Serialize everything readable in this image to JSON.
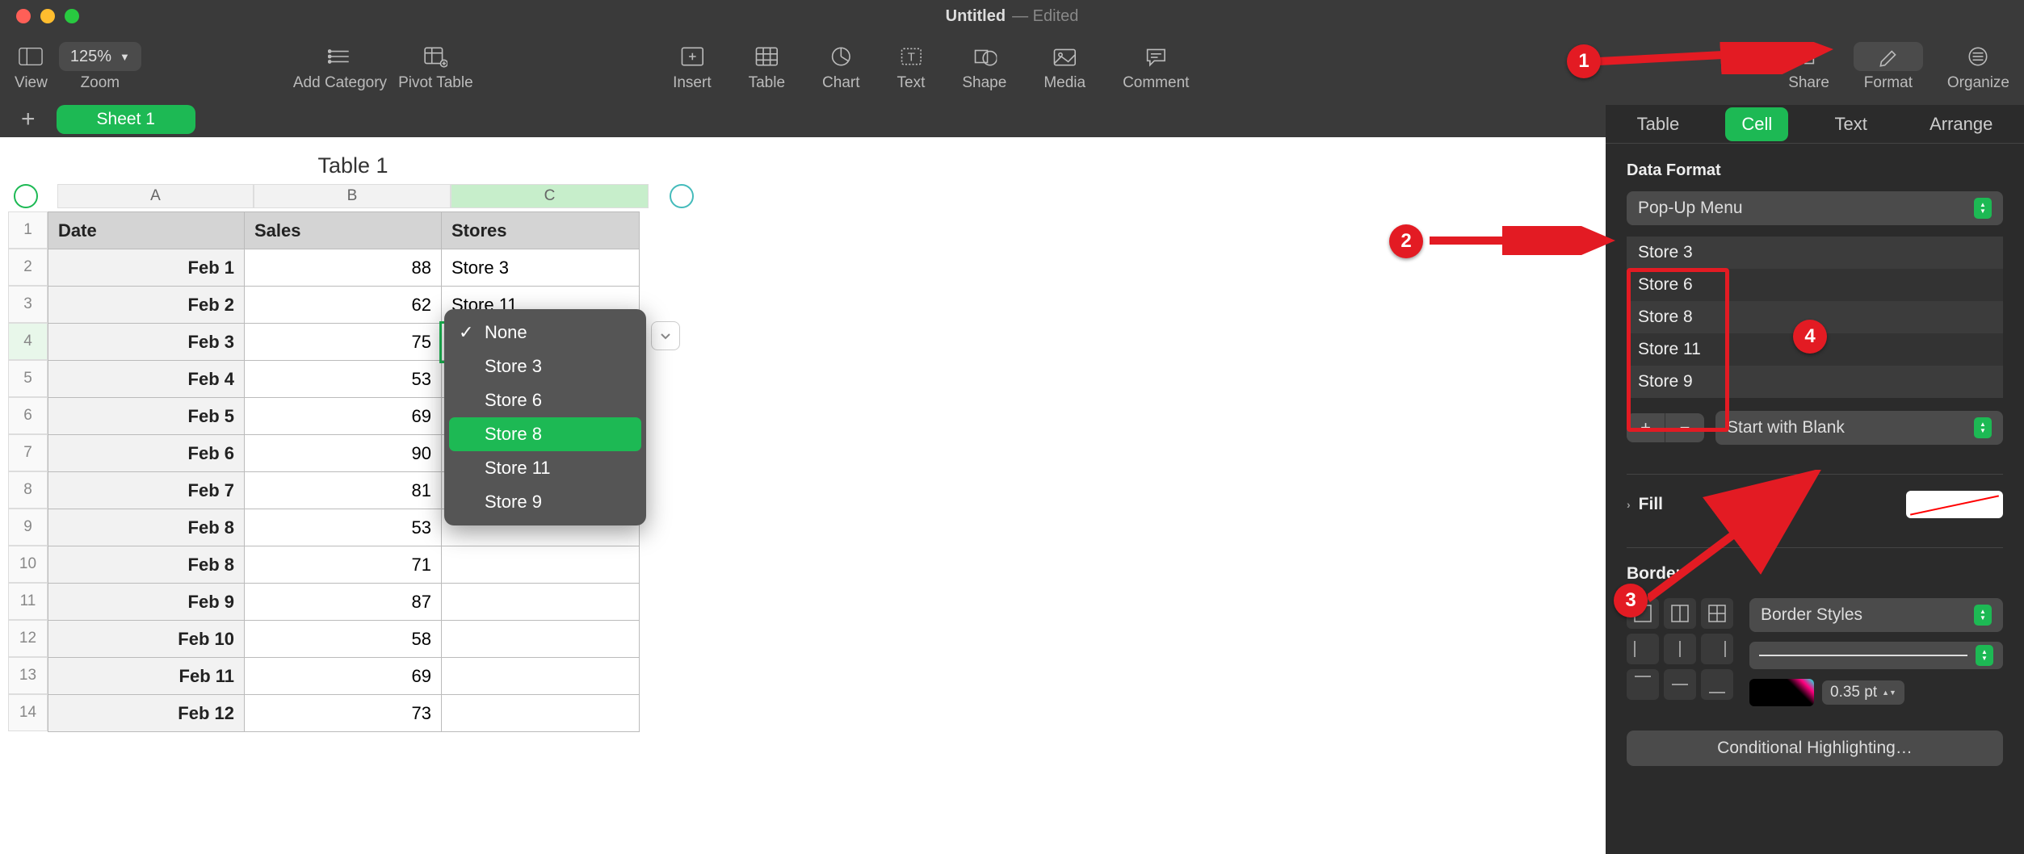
{
  "title": "Untitled",
  "title_suffix": "— Edited",
  "toolbar": {
    "view": "View",
    "zoom": "Zoom",
    "zoom_val": "125%",
    "add_category": "Add Category",
    "pivot_table": "Pivot Table",
    "insert": "Insert",
    "table": "Table",
    "chart": "Chart",
    "text": "Text",
    "shape": "Shape",
    "media": "Media",
    "comment": "Comment",
    "share": "Share",
    "format": "Format",
    "organize": "Organize"
  },
  "sheet_tab": "Sheet 1",
  "table_title": "Table 1",
  "cols": [
    "A",
    "B",
    "C"
  ],
  "headers": [
    "Date",
    "Sales",
    "Stores"
  ],
  "rows": [
    {
      "n": "1",
      "a": "",
      "b": "",
      "c": "",
      "hdr": true
    },
    {
      "n": "2",
      "a": "Feb 1",
      "b": "88",
      "c": "Store 3"
    },
    {
      "n": "3",
      "a": "Feb 2",
      "b": "62",
      "c": "Store 11"
    },
    {
      "n": "4",
      "a": "Feb 3",
      "b": "75",
      "c": "",
      "sel": true
    },
    {
      "n": "5",
      "a": "Feb 4",
      "b": "53",
      "c": ""
    },
    {
      "n": "6",
      "a": "Feb 5",
      "b": "69",
      "c": ""
    },
    {
      "n": "7",
      "a": "Feb 6",
      "b": "90",
      "c": ""
    },
    {
      "n": "8",
      "a": "Feb 7",
      "b": "81",
      "c": ""
    },
    {
      "n": "9",
      "a": "Feb 8",
      "b": "53",
      "c": ""
    },
    {
      "n": "10",
      "a": "Feb 8",
      "b": "71",
      "c": ""
    },
    {
      "n": "11",
      "a": "Feb 9",
      "b": "87",
      "c": ""
    },
    {
      "n": "12",
      "a": "Feb 10",
      "b": "58",
      "c": ""
    },
    {
      "n": "13",
      "a": "Feb 11",
      "b": "69",
      "c": ""
    },
    {
      "n": "14",
      "a": "Feb 12",
      "b": "73",
      "c": ""
    }
  ],
  "popup": {
    "items": [
      "None",
      "Store 3",
      "Store 6",
      "Store 8",
      "Store 11",
      "Store 9"
    ],
    "selected": "Store 8",
    "checked": "None"
  },
  "inspector": {
    "tabs": [
      "Table",
      "Cell",
      "Text",
      "Arrange"
    ],
    "active": "Cell",
    "data_format_label": "Data Format",
    "data_format_value": "Pop-Up Menu",
    "popup_items": [
      "Store 3",
      "Store 6",
      "Store 8",
      "Store 11",
      "Store 9"
    ],
    "start_with": "Start with Blank",
    "fill_label": "Fill",
    "border_label": "Border",
    "border_styles": "Border Styles",
    "pt": "0.35 pt",
    "cond": "Conditional Highlighting…"
  },
  "annotations": [
    "1",
    "2",
    "3",
    "4"
  ]
}
